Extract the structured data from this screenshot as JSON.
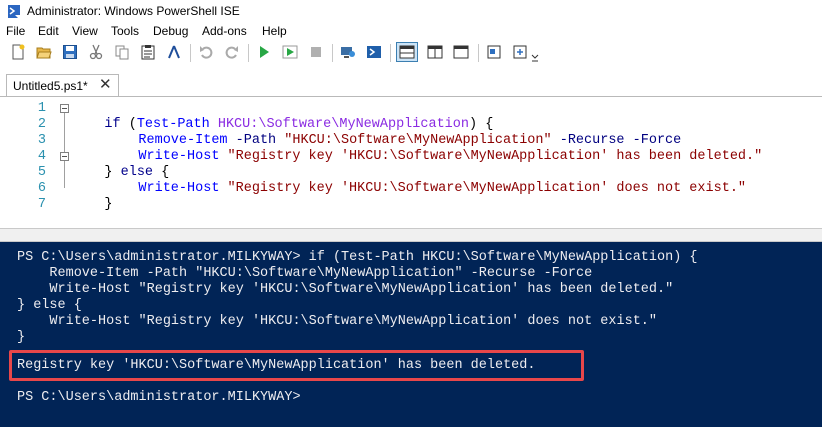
{
  "window": {
    "title": "Administrator: Windows PowerShell ISE",
    "icon": "powershell-ise-icon"
  },
  "menu": [
    "File",
    "Edit",
    "View",
    "Tools",
    "Debug",
    "Add-ons",
    "Help"
  ],
  "toolbar": {
    "icons": [
      "new-file-icon",
      "open-file-icon",
      "save-icon",
      "cut-icon",
      "copy-icon",
      "paste-icon",
      "clear-console-icon",
      "undo-icon",
      "redo-icon",
      "run-script-icon",
      "run-selection-icon",
      "stop-icon",
      "new-remote-tab-icon",
      "start-powershell-icon",
      "show-script-top-icon",
      "show-script-right-icon",
      "show-script-maximized-icon",
      "show-command-window-icon",
      "show-command-addon-icon"
    ]
  },
  "tab": {
    "label": "Untitled5.ps1*",
    "close": "✕"
  },
  "editor": {
    "line_numbers": [
      "1",
      "2",
      "3",
      "4",
      "5",
      "6",
      "7"
    ],
    "lines": [
      [
        "if",
        " (",
        "Test-Path",
        " ",
        "HKCU:\\Software\\MyNewApplication",
        ") {"
      ],
      [
        "Remove-Item",
        " ",
        "-Path",
        " ",
        "\"HKCU:\\Software\\MyNewApplication\"",
        " ",
        "-Recurse",
        " ",
        "-Force"
      ],
      [
        "Write-Host",
        " ",
        "\"Registry key 'HKCU:\\Software\\MyNewApplication' has been deleted.\""
      ],
      [
        "}",
        " ",
        "else",
        " {"
      ],
      [
        "Write-Host",
        " ",
        "\"Registry key 'HKCU:\\Software\\MyNewApplication' does not exist.\""
      ],
      [
        "}"
      ]
    ]
  },
  "console": {
    "lines": [
      "PS C:\\Users\\administrator.MILKYWAY> if (Test-Path HKCU:\\Software\\MyNewApplication) {",
      "    Remove-Item -Path \"HKCU:\\Software\\MyNewApplication\" -Recurse -Force",
      "    Write-Host \"Registry key 'HKCU:\\Software\\MyNewApplication' has been deleted.\"",
      "} else {",
      "    Write-Host \"Registry key 'HKCU:\\Software\\MyNewApplication' does not exist.\"",
      "}",
      "",
      "Registry key 'HKCU:\\Software\\MyNewApplication' has been deleted.",
      "",
      "PS C:\\Users\\administrator.MILKYWAY>"
    ]
  },
  "colors": {
    "console_bg": "#012456",
    "console_fg": "#eeedf0",
    "highlight_border": "#e8474a",
    "line_number": "#2b91af"
  }
}
